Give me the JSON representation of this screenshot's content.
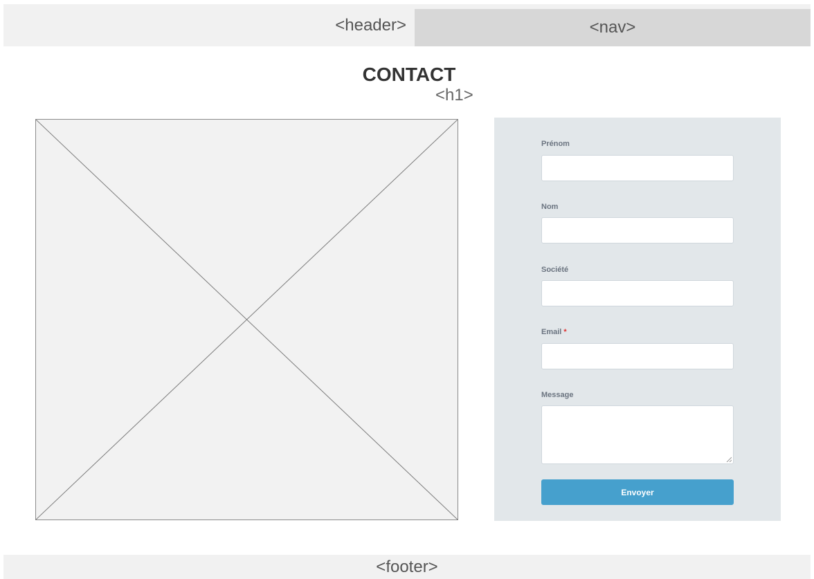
{
  "header": {
    "label": "<header>",
    "nav_label": "<nav>"
  },
  "main": {
    "title": "CONTACT",
    "title_tag": "<h1>"
  },
  "form": {
    "fields": [
      {
        "label": "Prénom",
        "value": "",
        "required": false
      },
      {
        "label": "Nom",
        "value": "",
        "required": false
      },
      {
        "label": "Société",
        "value": "",
        "required": false
      },
      {
        "label": "Email",
        "value": "",
        "required": true
      },
      {
        "label": "Message",
        "value": "",
        "required": false
      }
    ],
    "required_mark": "*",
    "submit_label": "Envoyer"
  },
  "footer": {
    "label": "<footer>"
  },
  "colors": {
    "form_background": "#e2e7ea",
    "button": "#46a0cd",
    "required": "#e03131",
    "placeholder_bar": "#f1f1f1",
    "nav_block": "#d7d7d7"
  }
}
